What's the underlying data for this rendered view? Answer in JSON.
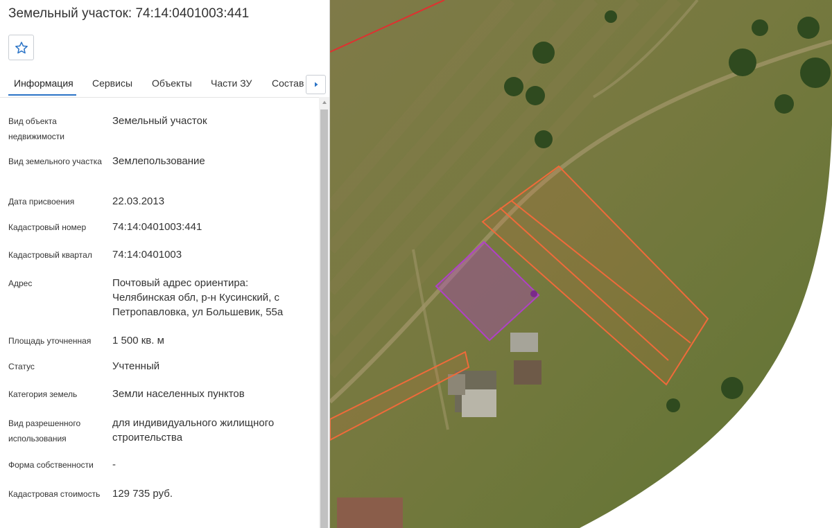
{
  "panel": {
    "title": "Земельный участок: 74:14:0401003:441",
    "tabs": [
      {
        "label": "Информация"
      },
      {
        "label": "Сервисы"
      },
      {
        "label": "Объекты"
      },
      {
        "label": "Части ЗУ"
      },
      {
        "label": "Состав"
      }
    ],
    "rows": [
      {
        "label": "Вид объекта недвижимости",
        "value": "Земельный участок"
      },
      {
        "label": "Вид земельного участка",
        "value": "Землепользование"
      },
      {
        "label": "Дата присвоения",
        "value": "22.03.2013"
      },
      {
        "label": "Кадастровый номер",
        "value": "74:14:0401003:441"
      },
      {
        "label": "Кадастровый квартал",
        "value": "74:14:0401003"
      },
      {
        "label": "Адрес",
        "value": "Почтовый адрес ориентира: Челябинская обл, р-н Кусинский, с Петропавловка, ул Большевик, 55а"
      },
      {
        "label": "Площадь уточненная",
        "value": "1 500 кв. м"
      },
      {
        "label": "Статус",
        "value": "Учтенный"
      },
      {
        "label": "Категория земель",
        "value": "Земли населенных пунктов"
      },
      {
        "label": "Вид разрешенного использования",
        "value": "для индивидуального жилищного строительства"
      },
      {
        "label": "Форма собственности",
        "value": "-"
      },
      {
        "label": "Кадастровая стоимость",
        "value": "129 735 руб."
      }
    ]
  },
  "icons": {
    "favorite": "star-outline-icon",
    "tabs_next": "caret-right-icon",
    "scroll_up": "caret-up-icon"
  },
  "colors": {
    "accent": "#2a73c6",
    "selected_parcel": "#b040c8",
    "parcel_outline": "#f06a3a",
    "boundary_line": "#e03030"
  }
}
